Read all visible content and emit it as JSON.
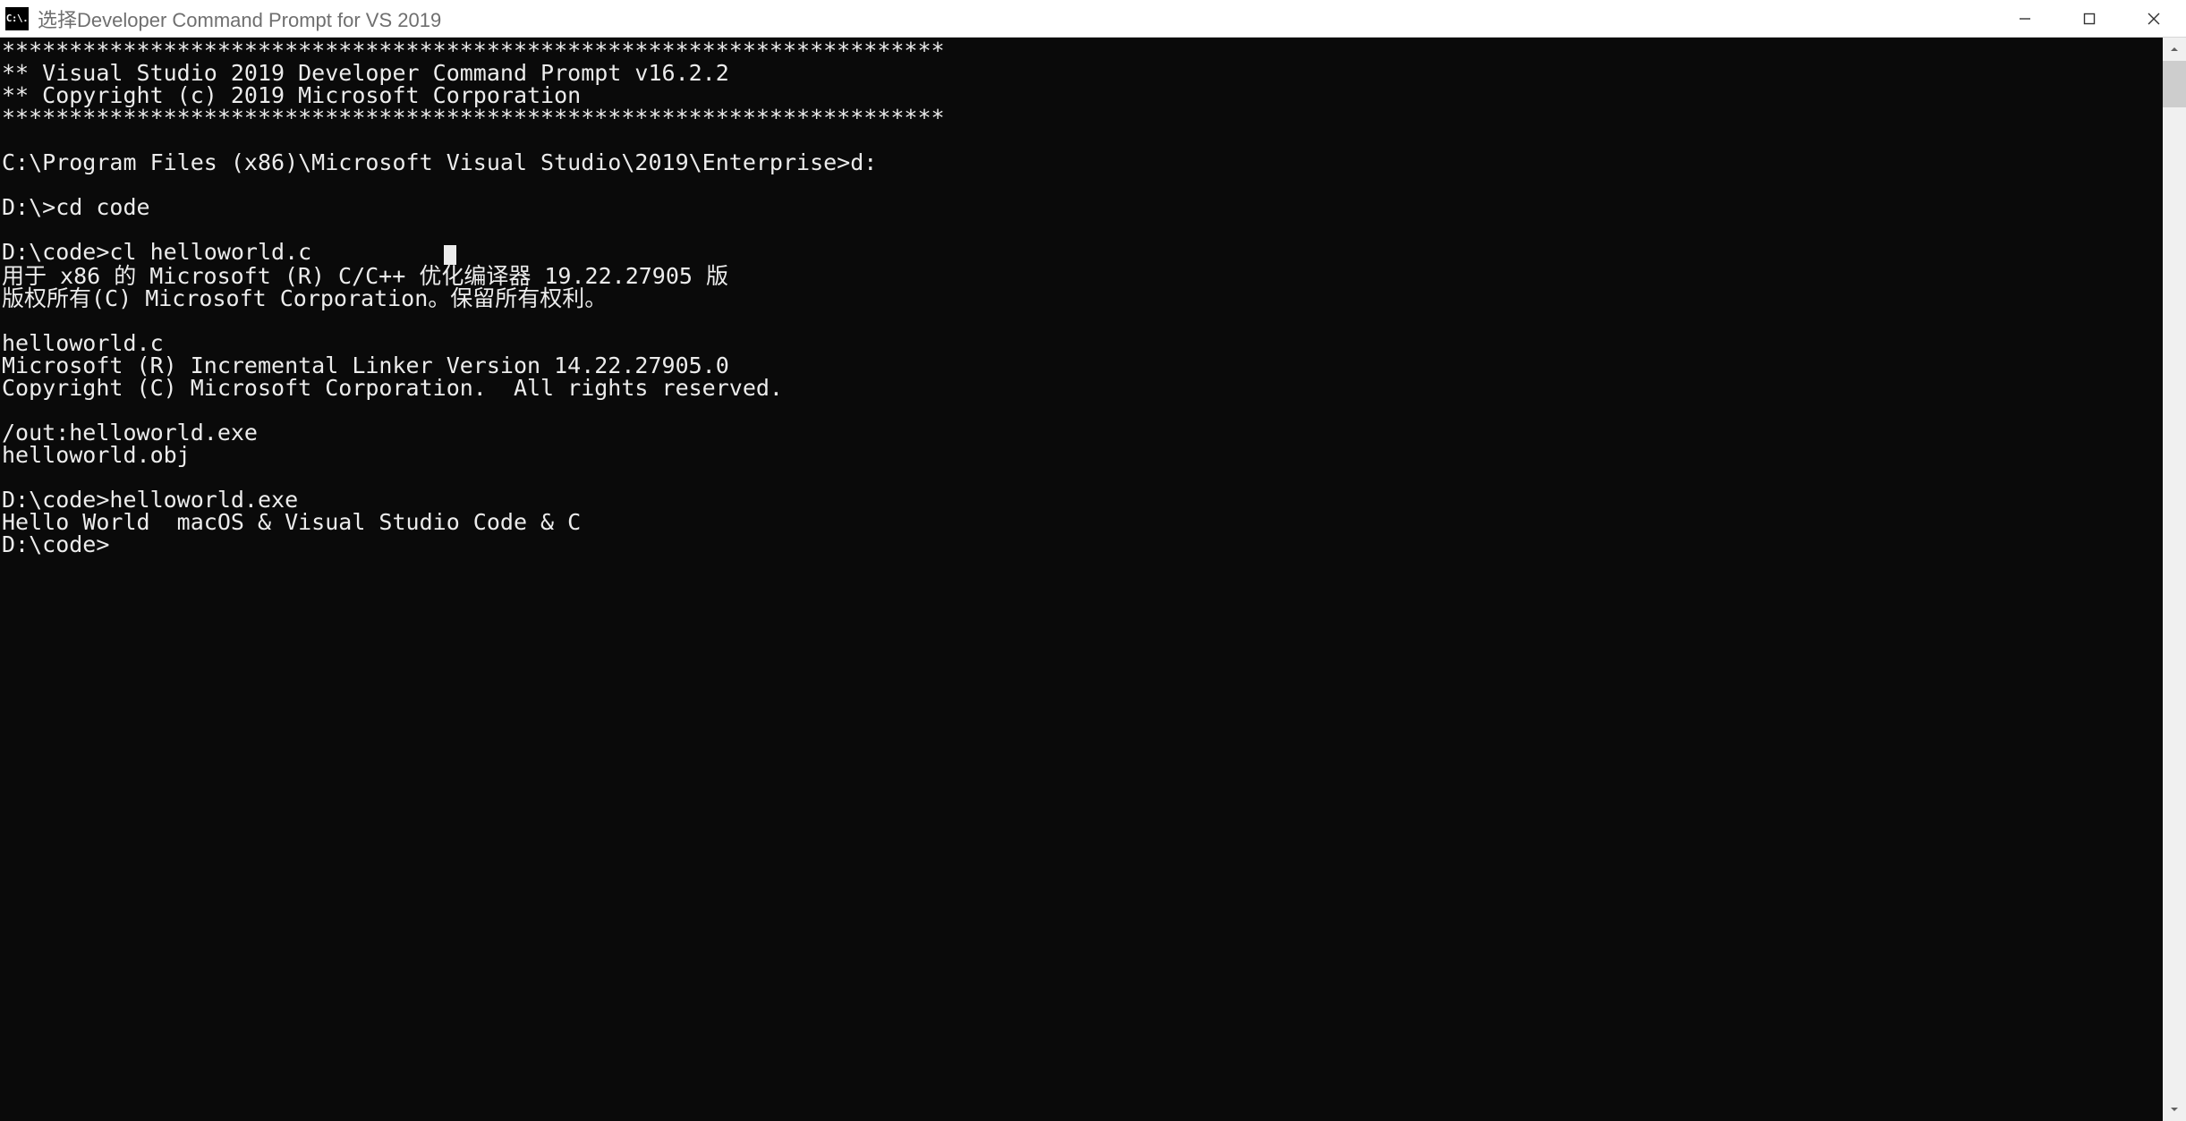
{
  "window": {
    "icon_label": "C:\\.",
    "title": "选择Developer Command Prompt for VS 2019"
  },
  "console": {
    "lines": [
      "**********************************************************************",
      "** Visual Studio 2019 Developer Command Prompt v16.2.2",
      "** Copyright (c) 2019 Microsoft Corporation",
      "**********************************************************************",
      "",
      "C:\\Program Files (x86)\\Microsoft Visual Studio\\2019\\Enterprise>d:",
      "",
      "D:\\>cd code",
      "",
      "D:\\code>cl helloworld.c",
      "用于 x86 的 Microsoft (R) C/C++ 优化编译器 19.22.27905 版",
      "版权所有(C) Microsoft Corporation。保留所有权利。",
      "",
      "helloworld.c",
      "Microsoft (R) Incremental Linker Version 14.22.27905.0",
      "Copyright (C) Microsoft Corporation.  All rights reserved.",
      "",
      "/out:helloworld.exe",
      "helloworld.obj",
      "",
      "D:\\code>helloworld.exe",
      "Hello World  macOS & Visual Studio Code & C",
      "D:\\code>"
    ],
    "cursor_line_index": 9
  }
}
